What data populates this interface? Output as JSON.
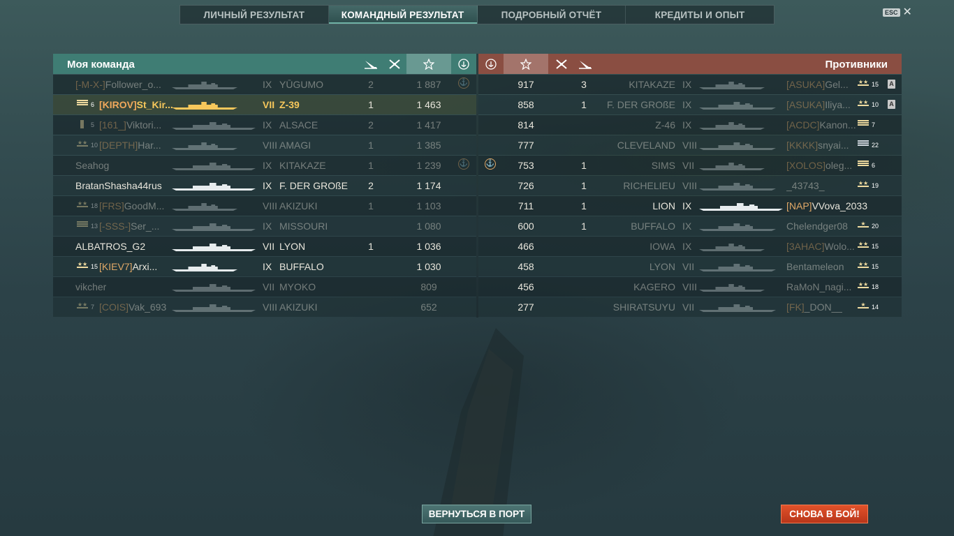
{
  "tabs": [
    {
      "label": "ЛИЧНЫЙ РЕЗУЛЬТАТ",
      "active": false
    },
    {
      "label": "КОМАНДНЫЙ РЕЗУЛЬТАТ",
      "active": true
    },
    {
      "label": "ПОДРОБНЫЙ ОТЧЁТ",
      "active": false
    },
    {
      "label": "КРЕДИТЫ И ОПЫТ",
      "active": false
    }
  ],
  "esc": {
    "badge": "ESC",
    "close": "✕"
  },
  "my_team": {
    "title": "Моя команда",
    "header_icons": [
      "torpedo-icon",
      "kills-icon",
      "star-icon",
      "anchor-icon"
    ],
    "players": [
      {
        "rank": "",
        "level": "",
        "clan": "[-M-X-]",
        "name": "Follower_o...",
        "tier": "IX",
        "ship": "YŪGUMO",
        "kills": "2",
        "score": "1 887",
        "anchor": true,
        "dim": true,
        "me": false
      },
      {
        "rank": "chev",
        "level": "6",
        "clan": "[KIROV]",
        "name": "St_Kir...",
        "tier": "VII",
        "ship": "Z-39",
        "kills": "1",
        "score": "1 463",
        "anchor": false,
        "dim": false,
        "me": true
      },
      {
        "rank": "bar",
        "level": "5",
        "clan": "[161_]",
        "name": "Viktori...",
        "tier": "IX",
        "ship": "ALSACE",
        "kills": "2",
        "score": "1 417",
        "anchor": false,
        "dim": true,
        "me": false
      },
      {
        "rank": "star",
        "level": "10",
        "clan": "[DEPTH]",
        "name": "Har...",
        "tier": "VIII",
        "ship": "AMAGI",
        "kills": "1",
        "score": "1 385",
        "anchor": false,
        "dim": true,
        "me": false
      },
      {
        "rank": "",
        "level": "",
        "clan": "",
        "name": "Seahog",
        "tier": "IX",
        "ship": "KITAKAZE",
        "kills": "1",
        "score": "1 239",
        "anchor": true,
        "dim": true,
        "me": false
      },
      {
        "rank": "",
        "level": "",
        "clan": "",
        "name": "BratanShasha44rus",
        "tier": "IX",
        "ship": "F. DER GROßE",
        "kills": "2",
        "score": "1 174",
        "anchor": false,
        "dim": false,
        "me": false
      },
      {
        "rank": "star",
        "level": "18",
        "clan": "[FRS]",
        "name": "GoodM...",
        "tier": "VIII",
        "ship": "AKIZUKI",
        "kills": "1",
        "score": "1 103",
        "anchor": false,
        "dim": true,
        "me": false
      },
      {
        "rank": "chev",
        "level": "13",
        "clan": "[-SSS-]",
        "name": "Ser_...",
        "tier": "IX",
        "ship": "MISSOURI",
        "kills": "",
        "score": "1 080",
        "anchor": false,
        "dim": true,
        "me": false
      },
      {
        "rank": "",
        "level": "",
        "clan": "",
        "name": "ALBATROS_G2",
        "tier": "VII",
        "ship": "LYON",
        "kills": "1",
        "score": "1 036",
        "anchor": false,
        "dim": false,
        "me": false
      },
      {
        "rank": "star",
        "level": "15",
        "clan": "[KIEV7]",
        "name": "Arxi...",
        "tier": "IX",
        "ship": "BUFFALO",
        "kills": "",
        "score": "1 030",
        "anchor": false,
        "dim": false,
        "me": false
      },
      {
        "rank": "",
        "level": "",
        "clan": "",
        "name": "vikcher",
        "tier": "VII",
        "ship": "MYOKO",
        "kills": "",
        "score": "809",
        "anchor": false,
        "dim": true,
        "me": false
      },
      {
        "rank": "star",
        "level": "7",
        "clan": "[COIS]",
        "name": "Vak_693",
        "tier": "VIII",
        "ship": "AKIZUKI",
        "kills": "",
        "score": "652",
        "anchor": false,
        "dim": true,
        "me": false
      }
    ]
  },
  "enemy_team": {
    "title": "Противники",
    "header_icons": [
      "anchor-icon",
      "star-icon",
      "kills-icon",
      "torpedo-icon"
    ],
    "players": [
      {
        "anchor": false,
        "score": "917",
        "kills": "3",
        "ship": "KITAKAZE",
        "tier": "IX",
        "clan": "[ASUKA]",
        "name": "Gel...",
        "rank": "star",
        "level": "15",
        "badge": true,
        "dim": true
      },
      {
        "anchor": false,
        "score": "858",
        "kills": "1",
        "ship": "F. DER GROßE",
        "tier": "IX",
        "clan": "[ASUKA]",
        "name": "Iliya...",
        "rank": "star",
        "level": "10",
        "badge": true,
        "dim": true
      },
      {
        "anchor": false,
        "score": "814",
        "kills": "",
        "ship": "Z-46",
        "tier": "IX",
        "clan": "[ACDC]",
        "name": "Kanon...",
        "rank": "chev",
        "level": "7",
        "badge": false,
        "dim": true
      },
      {
        "anchor": false,
        "score": "777",
        "kills": "",
        "ship": "CLEVELAND",
        "tier": "VIII",
        "clan": "[KKKK]",
        "name": "snyai...",
        "rank": "bars",
        "level": "22",
        "badge": false,
        "dim": true
      },
      {
        "anchor": true,
        "score": "753",
        "kills": "1",
        "ship": "SIMS",
        "tier": "VII",
        "clan": "[XOLOS]",
        "name": "oleg...",
        "rank": "chev",
        "level": "6",
        "badge": false,
        "dim": true
      },
      {
        "anchor": false,
        "score": "726",
        "kills": "1",
        "ship": "RICHELIEU",
        "tier": "VIII",
        "clan": "",
        "name": "_43743_",
        "rank": "star",
        "level": "19",
        "badge": false,
        "dim": true
      },
      {
        "anchor": false,
        "score": "711",
        "kills": "1",
        "ship": "LION",
        "tier": "IX",
        "clan": "[NAP]",
        "name": "VVova_2033",
        "rank": "",
        "level": "",
        "badge": false,
        "dim": false
      },
      {
        "anchor": false,
        "score": "600",
        "kills": "1",
        "ship": "BUFFALO",
        "tier": "IX",
        "clan": "",
        "name": "Chelendger08",
        "rank": "star1",
        "level": "20",
        "badge": false,
        "dim": true
      },
      {
        "anchor": false,
        "score": "466",
        "kills": "",
        "ship": "IOWA",
        "tier": "IX",
        "clan": "[3AHAC]",
        "name": "Wolo...",
        "rank": "star",
        "level": "15",
        "badge": false,
        "dim": true
      },
      {
        "anchor": false,
        "score": "458",
        "kills": "",
        "ship": "LYON",
        "tier": "VII",
        "clan": "",
        "name": "Bentameleon",
        "rank": "star",
        "level": "15",
        "badge": false,
        "dim": true
      },
      {
        "anchor": false,
        "score": "456",
        "kills": "",
        "ship": "KAGERO",
        "tier": "VIII",
        "clan": "",
        "name": "RaMoN_nagi...",
        "rank": "star",
        "level": "18",
        "badge": false,
        "dim": true
      },
      {
        "anchor": false,
        "score": "277",
        "kills": "",
        "ship": "SHIRATSUYU",
        "tier": "VII",
        "clan": "[FK]",
        "name": "_DON__",
        "rank": "star1",
        "level": "14",
        "badge": false,
        "dim": true
      }
    ]
  },
  "buttons": {
    "port": "ВЕРНУТЬСЯ В ПОРТ",
    "battle": "СНОВА В БОЙ!"
  },
  "colors": {
    "my_team_header": "#3f7d74",
    "enemy_header": "#8a4e42",
    "clan_tag": "#e0a867",
    "my_player": "#f6c75b",
    "battle_button": "#d2441f"
  }
}
